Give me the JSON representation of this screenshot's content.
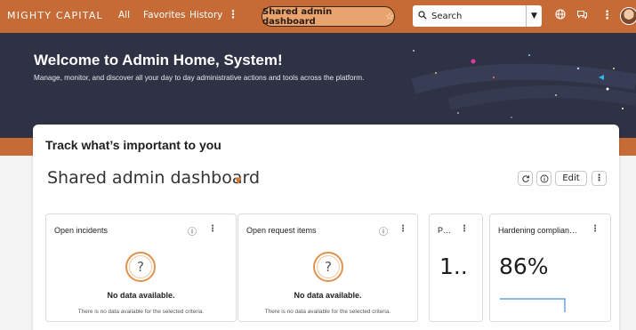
{
  "topbar": {
    "brand": "MIGHTY CAPITAL",
    "nav": [
      "All",
      "Favorites",
      "History"
    ],
    "more": "⋮",
    "pill_label": "Shared admin dashboard",
    "pill_star": "☆",
    "search_placeholder": "Search",
    "icons": [
      "globe-icon",
      "chat-icon",
      "more-icon",
      "avatar"
    ]
  },
  "hero": {
    "title": "Welcome to Admin Home, System!",
    "subtitle": "Manage, monitor, and discover all your day to day administrative actions and tools across the platform."
  },
  "main": {
    "track_title": "Track what’s important to you",
    "dashboard_title": "Shared admin dashboard",
    "edit_label": "Edit"
  },
  "widgets": [
    {
      "title": "Open incidents",
      "nodata": "No data available.",
      "nodata_sub": "There is no data available for the selected criteria."
    },
    {
      "title": "Open request items",
      "nodata": "No data available.",
      "nodata_sub": "There is no data available for the selected criteria."
    },
    {
      "title": "P…",
      "value": "1.."
    },
    {
      "title": "Hardening complian…",
      "value": "86%"
    }
  ],
  "colors": {
    "brand": "#c76b36",
    "hero": "#2e3244",
    "accent": "#e0934e"
  }
}
